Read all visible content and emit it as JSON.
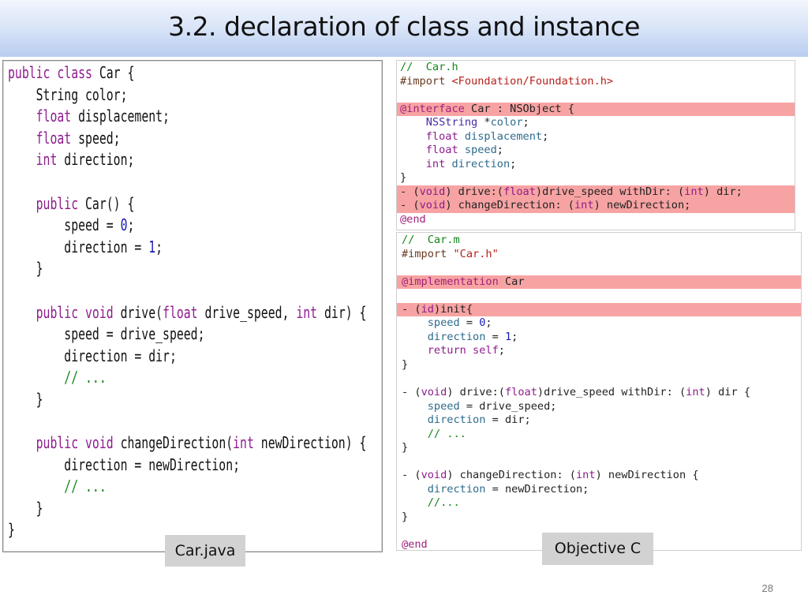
{
  "slide": {
    "title": "3.2. declaration of class and instance",
    "page_number": "28",
    "java_label": "Car.java",
    "objc_label": "Objective C"
  },
  "colors": {
    "keyword": "#8e1c8e",
    "number": "#1a1ab4",
    "comment": "#15851a",
    "string": "#b5201a",
    "highlight": "#f7a3a3",
    "title_gradient_bottom": "#b9cdf0"
  },
  "java_code": [
    [
      [
        "kw",
        "public class"
      ],
      [
        "t",
        " Car {"
      ]
    ],
    [
      [
        "t",
        "    String color;"
      ]
    ],
    [
      [
        "t",
        "    "
      ],
      [
        "kw",
        "float"
      ],
      [
        "t",
        " displacement;"
      ]
    ],
    [
      [
        "t",
        "    "
      ],
      [
        "kw",
        "float"
      ],
      [
        "t",
        " speed;"
      ]
    ],
    [
      [
        "t",
        "    "
      ],
      [
        "kw",
        "int"
      ],
      [
        "t",
        " direction;"
      ]
    ],
    [],
    [
      [
        "t",
        "    "
      ],
      [
        "kw",
        "public"
      ],
      [
        "t",
        " Car() {"
      ]
    ],
    [
      [
        "t",
        "        speed = "
      ],
      [
        "num",
        "0"
      ],
      [
        "t",
        ";"
      ]
    ],
    [
      [
        "t",
        "        direction = "
      ],
      [
        "num",
        "1"
      ],
      [
        "t",
        ";"
      ]
    ],
    [
      [
        "t",
        "    }"
      ]
    ],
    [],
    [
      [
        "t",
        "    "
      ],
      [
        "kw",
        "public void"
      ],
      [
        "t",
        " drive("
      ],
      [
        "kw",
        "float"
      ],
      [
        "t",
        " drive_speed, "
      ],
      [
        "kw",
        "int"
      ],
      [
        "t",
        " dir) {"
      ]
    ],
    [
      [
        "t",
        "        speed = drive_speed;"
      ]
    ],
    [
      [
        "t",
        "        direction = dir;"
      ]
    ],
    [
      [
        "t",
        "        "
      ],
      [
        "cmt",
        "// ..."
      ]
    ],
    [
      [
        "t",
        "    }"
      ]
    ],
    [],
    [
      [
        "t",
        "    "
      ],
      [
        "kw",
        "public void"
      ],
      [
        "t",
        " changeDirection("
      ],
      [
        "kw",
        "int"
      ],
      [
        "t",
        " newDirection) {"
      ]
    ],
    [
      [
        "t",
        "        direction = newDirection;"
      ]
    ],
    [
      [
        "t",
        "        "
      ],
      [
        "cmt",
        "// ..."
      ]
    ],
    [
      [
        "t",
        "    }"
      ]
    ],
    [
      [
        "t",
        "}"
      ]
    ]
  ],
  "objc_header_code": [
    {
      "hl": false,
      "tokens": [
        [
          "cmt",
          "//  Car.h"
        ]
      ]
    },
    {
      "hl": false,
      "tokens": [
        [
          "dir",
          "#import "
        ],
        [
          "str",
          "<Foundation/Foundation.h>"
        ]
      ]
    },
    {
      "hl": false,
      "tokens": []
    },
    {
      "hl": true,
      "tokens": [
        [
          "at",
          "@interface"
        ],
        [
          "t",
          " Car : NSObject {"
        ]
      ]
    },
    {
      "hl": false,
      "tokens": [
        [
          "t",
          "    "
        ],
        [
          "type",
          "NSString"
        ],
        [
          "t",
          " *"
        ],
        [
          "ivar",
          "color"
        ],
        [
          "t",
          ";"
        ]
      ]
    },
    {
      "hl": false,
      "tokens": [
        [
          "t",
          "    "
        ],
        [
          "kw",
          "float"
        ],
        [
          "t",
          " "
        ],
        [
          "ivar",
          "displacement"
        ],
        [
          "t",
          ";"
        ]
      ]
    },
    {
      "hl": false,
      "tokens": [
        [
          "t",
          "    "
        ],
        [
          "kw",
          "float"
        ],
        [
          "t",
          " "
        ],
        [
          "ivar",
          "speed"
        ],
        [
          "t",
          ";"
        ]
      ]
    },
    {
      "hl": false,
      "tokens": [
        [
          "t",
          "    "
        ],
        [
          "kw",
          "int"
        ],
        [
          "t",
          " "
        ],
        [
          "ivar",
          "direction"
        ],
        [
          "t",
          ";"
        ]
      ]
    },
    {
      "hl": false,
      "tokens": [
        [
          "t",
          "}"
        ]
      ]
    },
    {
      "hl": true,
      "tokens": [
        [
          "t",
          "- ("
        ],
        [
          "kw",
          "void"
        ],
        [
          "t",
          ") drive:("
        ],
        [
          "kw",
          "float"
        ],
        [
          "t",
          ")drive_speed withDir: ("
        ],
        [
          "kw",
          "int"
        ],
        [
          "t",
          ") dir;"
        ]
      ]
    },
    {
      "hl": true,
      "tokens": [
        [
          "t",
          "- ("
        ],
        [
          "kw",
          "void"
        ],
        [
          "t",
          ") changeDirection: ("
        ],
        [
          "kw",
          "int"
        ],
        [
          "t",
          ") newDirection;"
        ]
      ]
    },
    {
      "hl": false,
      "tokens": [
        [
          "at",
          "@end"
        ]
      ]
    }
  ],
  "objc_impl_code": [
    {
      "hl": false,
      "tokens": [
        [
          "cmt",
          "//  Car.m"
        ]
      ]
    },
    {
      "hl": false,
      "tokens": [
        [
          "dir",
          "#import "
        ],
        [
          "str",
          "\"Car.h\""
        ]
      ]
    },
    {
      "hl": false,
      "tokens": []
    },
    {
      "hl": true,
      "tokens": [
        [
          "at",
          "@implementation"
        ],
        [
          "t",
          " Car"
        ]
      ]
    },
    {
      "hl": false,
      "tokens": []
    },
    {
      "hl": true,
      "tokens": [
        [
          "t",
          "- ("
        ],
        [
          "kw",
          "id"
        ],
        [
          "t",
          ")init{"
        ]
      ]
    },
    {
      "hl": false,
      "tokens": [
        [
          "t",
          "    "
        ],
        [
          "ivar",
          "speed"
        ],
        [
          "t",
          " = "
        ],
        [
          "num",
          "0"
        ],
        [
          "t",
          ";"
        ]
      ]
    },
    {
      "hl": false,
      "tokens": [
        [
          "t",
          "    "
        ],
        [
          "ivar",
          "direction"
        ],
        [
          "t",
          " = "
        ],
        [
          "num",
          "1"
        ],
        [
          "t",
          ";"
        ]
      ]
    },
    {
      "hl": false,
      "tokens": [
        [
          "t",
          "    "
        ],
        [
          "kw",
          "return"
        ],
        [
          "t",
          " "
        ],
        [
          "kw",
          "self"
        ],
        [
          "t",
          ";"
        ]
      ]
    },
    {
      "hl": false,
      "tokens": [
        [
          "t",
          "}"
        ]
      ]
    },
    {
      "hl": false,
      "tokens": []
    },
    {
      "hl": false,
      "tokens": [
        [
          "t",
          "- ("
        ],
        [
          "kw",
          "void"
        ],
        [
          "t",
          ") drive:("
        ],
        [
          "kw",
          "float"
        ],
        [
          "t",
          ")drive_speed withDir: ("
        ],
        [
          "kw",
          "int"
        ],
        [
          "t",
          ") dir {"
        ]
      ]
    },
    {
      "hl": false,
      "tokens": [
        [
          "t",
          "    "
        ],
        [
          "ivar",
          "speed"
        ],
        [
          "t",
          " = drive_speed;"
        ]
      ]
    },
    {
      "hl": false,
      "tokens": [
        [
          "t",
          "    "
        ],
        [
          "ivar",
          "direction"
        ],
        [
          "t",
          " = dir;"
        ]
      ]
    },
    {
      "hl": false,
      "tokens": [
        [
          "t",
          "    "
        ],
        [
          "cmt",
          "// ..."
        ]
      ]
    },
    {
      "hl": false,
      "tokens": [
        [
          "t",
          "}"
        ]
      ]
    },
    {
      "hl": false,
      "tokens": []
    },
    {
      "hl": false,
      "tokens": [
        [
          "t",
          "- ("
        ],
        [
          "kw",
          "void"
        ],
        [
          "t",
          ") changeDirection: ("
        ],
        [
          "kw",
          "int"
        ],
        [
          "t",
          ") newDirection {"
        ]
      ]
    },
    {
      "hl": false,
      "tokens": [
        [
          "t",
          "    "
        ],
        [
          "ivar",
          "direction"
        ],
        [
          "t",
          " = newDirection;"
        ]
      ]
    },
    {
      "hl": false,
      "tokens": [
        [
          "t",
          "    "
        ],
        [
          "cmt",
          "//..."
        ]
      ]
    },
    {
      "hl": false,
      "tokens": [
        [
          "t",
          "}"
        ]
      ]
    },
    {
      "hl": false,
      "tokens": []
    },
    {
      "hl": false,
      "tokens": [
        [
          "at",
          "@end"
        ]
      ]
    }
  ]
}
